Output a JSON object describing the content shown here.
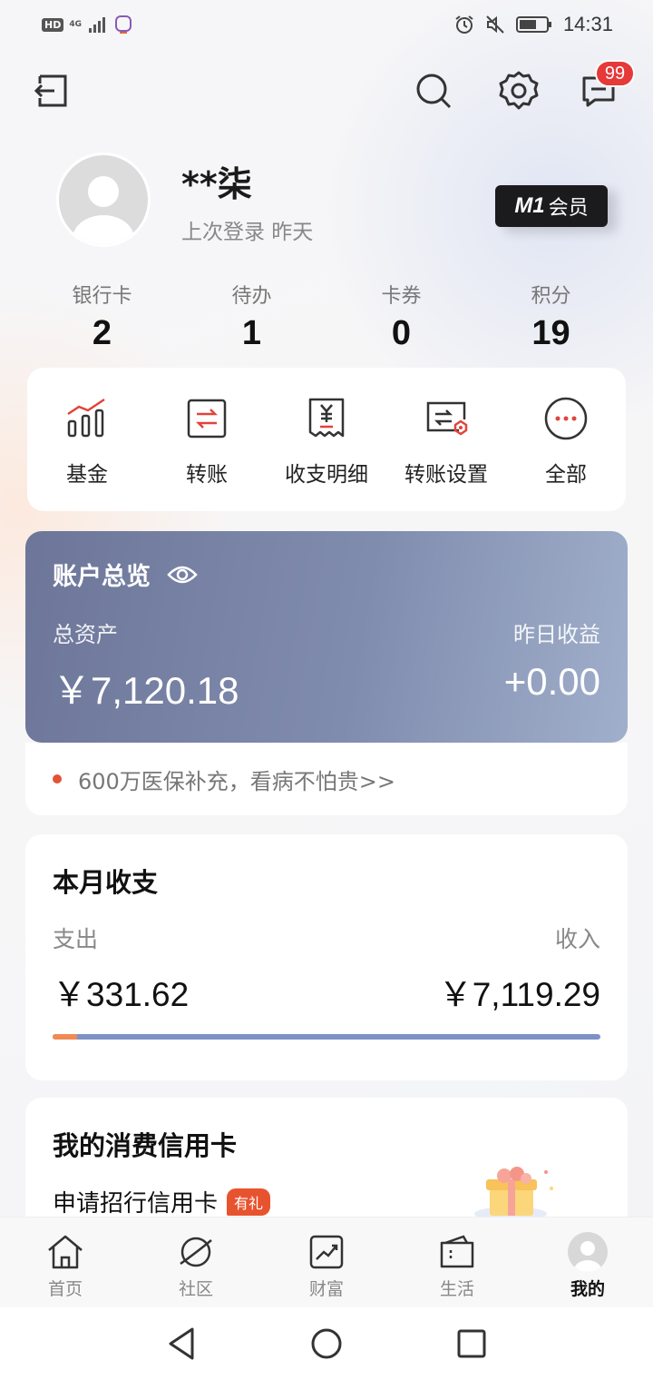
{
  "status_bar": {
    "hd": "HD",
    "network": "4G",
    "time": "14:31"
  },
  "header": {
    "notification_count": "99"
  },
  "profile": {
    "name": "**柒",
    "last_login": "上次登录 昨天",
    "member_badge_m1": "M1",
    "member_badge_text": "会员"
  },
  "stats": [
    {
      "label": "银行卡",
      "value": "2"
    },
    {
      "label": "待办",
      "value": "1"
    },
    {
      "label": "卡券",
      "value": "0"
    },
    {
      "label": "积分",
      "value": "19"
    }
  ],
  "quick_actions": [
    {
      "label": "基金",
      "icon": "fund-chart-icon"
    },
    {
      "label": "转账",
      "icon": "transfer-icon"
    },
    {
      "label": "收支明细",
      "icon": "receipt-icon"
    },
    {
      "label": "转账设置",
      "icon": "transfer-settings-icon"
    },
    {
      "label": "全部",
      "icon": "more-icon"
    }
  ],
  "overview": {
    "title": "账户总览",
    "asset_label": "总资产",
    "asset_value": "￥7,120.18",
    "yield_label": "昨日收益",
    "yield_value": "+0.00",
    "promo": "600万医保补充，看病不怕贵>>"
  },
  "monthly": {
    "title": "本月收支",
    "expense_label": "支出",
    "expense_value": "￥331.62",
    "income_label": "收入",
    "income_value": "￥7,119.29",
    "expense_ratio": 0.045
  },
  "credit": {
    "title": "我的消费信用卡",
    "apply": "申请招行信用卡",
    "tag": "有礼"
  },
  "bottom_nav": [
    {
      "label": "首页",
      "icon": "home-icon"
    },
    {
      "label": "社区",
      "icon": "planet-icon"
    },
    {
      "label": "财富",
      "icon": "wealth-chart-icon"
    },
    {
      "label": "生活",
      "icon": "wallet-icon"
    },
    {
      "label": "我的",
      "icon": "avatar-icon",
      "active": true
    }
  ],
  "colors": {
    "accent_red": "#e63939",
    "overview_start": "#6d7699",
    "overview_end": "#a0afcb",
    "expense_bar": "#f08a55",
    "income_bar": "#7e91c7"
  }
}
